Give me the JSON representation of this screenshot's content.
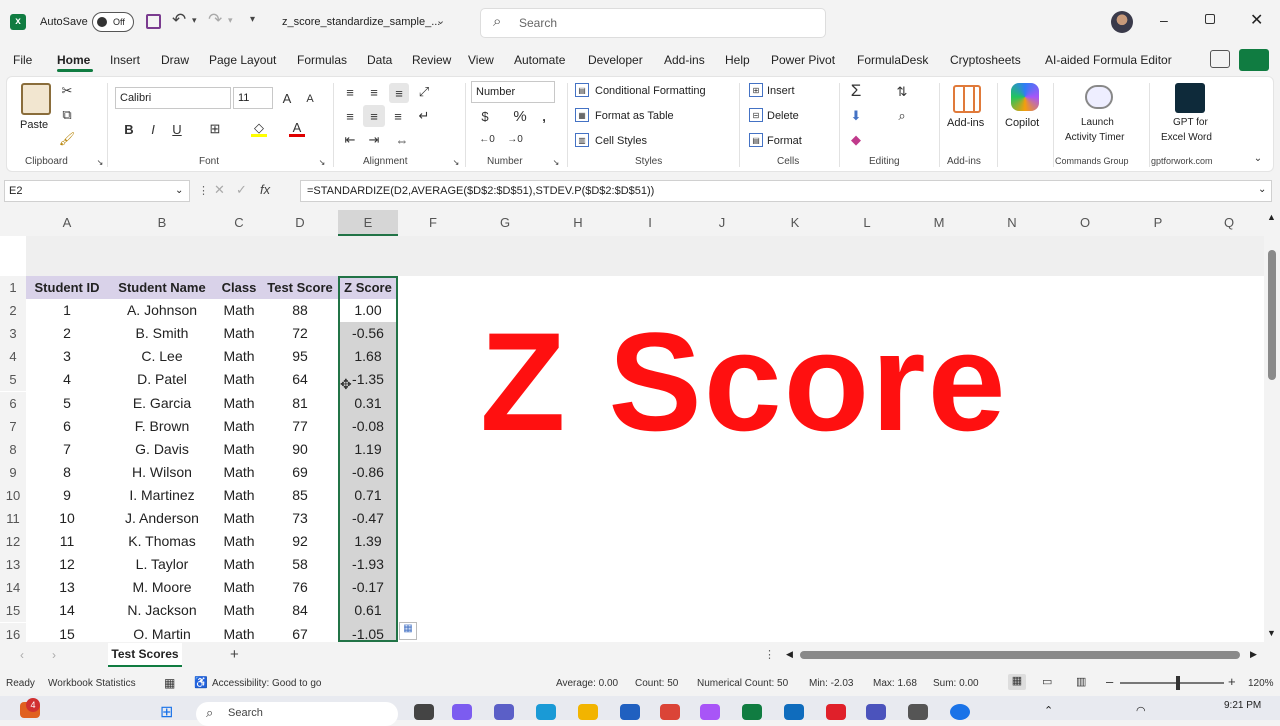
{
  "titlebar": {
    "autosave_label": "AutoSave",
    "autosave_state": "Off",
    "filename": "z_score_standardize_sample_...",
    "search_placeholder": "Search"
  },
  "menu": {
    "tabs": [
      "File",
      "Home",
      "Insert",
      "Draw",
      "Page Layout",
      "Formulas",
      "Data",
      "Review",
      "View",
      "Automate",
      "Developer",
      "Add-ins",
      "Help",
      "Power Pivot",
      "FormulaDesk",
      "Cryptosheets",
      "AI-aided Formula Editor"
    ],
    "active": "Home"
  },
  "ribbon": {
    "clipboard": {
      "paste": "Paste",
      "label": "Clipboard"
    },
    "font": {
      "name": "Calibri",
      "size": "11",
      "label": "Font",
      "bold": "B",
      "italic": "I",
      "underline": "U"
    },
    "alignment": {
      "label": "Alignment"
    },
    "number": {
      "format": "Number",
      "label": "Number",
      "currency": "$",
      "percent": "%"
    },
    "styles": {
      "conditional": "Conditional Formatting",
      "table": "Format as Table",
      "cell": "Cell Styles",
      "label": "Styles"
    },
    "cells": {
      "insert": "Insert",
      "delete": "Delete",
      "format": "Format",
      "label": "Cells"
    },
    "editing": {
      "label": "Editing",
      "sum": "Σ"
    },
    "addins": {
      "button": "Add-ins",
      "label": "Add-ins"
    },
    "copilot": {
      "button": "Copilot"
    },
    "commands": {
      "line1": "Launch",
      "line2": "Activity Timer",
      "label": "Commands Group"
    },
    "gpt": {
      "line1": "GPT for",
      "line2": "Excel Word",
      "label": "gptforwork.com"
    }
  },
  "formula_bar": {
    "name_box": "E2",
    "fx": "fx",
    "formula": "=STANDARDIZE(D2,AVERAGE($D$2:$D$51),STDEV.P($D$2:$D$51))"
  },
  "sheet": {
    "columns": [
      "A",
      "B",
      "C",
      "D",
      "E",
      "F",
      "G",
      "H",
      "I",
      "J",
      "K",
      "L",
      "M",
      "N",
      "O",
      "P",
      "Q"
    ],
    "headers": [
      "Student ID",
      "Student Name",
      "Class",
      "Test Score",
      "Z Score"
    ],
    "row_numbers": [
      "1",
      "2",
      "3",
      "4",
      "5",
      "6",
      "7",
      "8",
      "9",
      "10",
      "11",
      "12",
      "13",
      "14",
      "15",
      "16"
    ],
    "rows": [
      [
        "1",
        "A. Johnson",
        "Math",
        "88",
        "1.00"
      ],
      [
        "2",
        "B. Smith",
        "Math",
        "72",
        "-0.56"
      ],
      [
        "3",
        "C. Lee",
        "Math",
        "95",
        "1.68"
      ],
      [
        "4",
        "D. Patel",
        "Math",
        "64",
        "-1.35"
      ],
      [
        "5",
        "E. Garcia",
        "Math",
        "81",
        "0.31"
      ],
      [
        "6",
        "F. Brown",
        "Math",
        "77",
        "-0.08"
      ],
      [
        "7",
        "G. Davis",
        "Math",
        "90",
        "1.19"
      ],
      [
        "8",
        "H. Wilson",
        "Math",
        "69",
        "-0.86"
      ],
      [
        "9",
        "I. Martinez",
        "Math",
        "85",
        "0.71"
      ],
      [
        "10",
        "J. Anderson",
        "Math",
        "73",
        "-0.47"
      ],
      [
        "11",
        "K. Thomas",
        "Math",
        "92",
        "1.39"
      ],
      [
        "12",
        "L. Taylor",
        "Math",
        "58",
        "-1.93"
      ],
      [
        "13",
        "M. Moore",
        "Math",
        "76",
        "-0.17"
      ],
      [
        "14",
        "N. Jackson",
        "Math",
        "84",
        "0.61"
      ],
      [
        "15",
        "O. Martin",
        "Math",
        "67",
        "-1.05"
      ]
    ],
    "overlay_title": "Z Score"
  },
  "sheet_tabs": {
    "active": "Test Scores",
    "add": "+"
  },
  "status": {
    "ready": "Ready",
    "workbook_stats": "Workbook Statistics",
    "accessibility": "Accessibility: Good to go",
    "average": "Average: 0.00",
    "count": "Count: 50",
    "numerical_count": "Numerical Count: 50",
    "min": "Min: -2.03",
    "max": "Max: 1.68",
    "sum": "Sum: 0.00",
    "zoom": "120%"
  },
  "taskbar": {
    "search": "Search",
    "time": "9:21 PM",
    "badge": "4"
  }
}
